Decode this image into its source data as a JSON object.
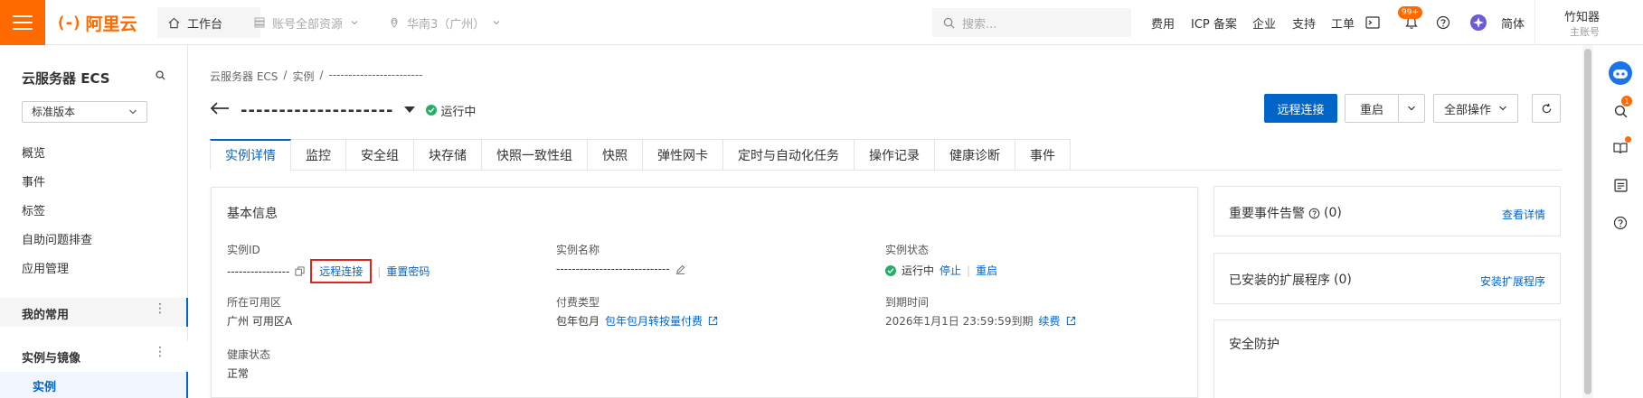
{
  "topbar": {
    "logo_text": "阿里云",
    "logo_mark": "(-)",
    "workbench": "工作台",
    "account_scope": "账号全部资源",
    "region": "华南3（广州）",
    "search_placeholder": "搜索...",
    "links": [
      "费用",
      "ICP 备案",
      "企业",
      "支持",
      "工单"
    ],
    "notify_badge": "99+",
    "lang": "简体",
    "user_name": "竹知器",
    "user_sub": "主账号",
    "accent_color": "#ff6a00"
  },
  "sidebar": {
    "title": "云服务器 ECS",
    "version": "标准版本",
    "items": [
      "概览",
      "事件",
      "标签",
      "自助问题排查",
      "应用管理"
    ],
    "section_favorites": "我的常用",
    "section_instances": "实例与镜像",
    "active_item": "实例"
  },
  "breadcrumb": [
    "云服务器 ECS",
    "/",
    "实例",
    "/",
    "------------------------"
  ],
  "header": {
    "instance_title": "--------------------",
    "status": "运行中",
    "btn_remote": "远程连接",
    "btn_restart": "重启",
    "btn_all_ops": "全部操作",
    "primary_color": "#0064c8"
  },
  "tabs": [
    "实例详情",
    "监控",
    "安全组",
    "块存储",
    "快照一致性组",
    "快照",
    "弹性网卡",
    "定时与自动化任务",
    "操作记录",
    "健康诊断",
    "事件"
  ],
  "basic_info": {
    "title": "基本信息",
    "instance_id_label": "实例ID",
    "instance_id_value": "----------------",
    "remote_link": "远程连接",
    "reset_pwd_link": "重置密码",
    "name_label": "实例名称",
    "name_value": "-----------------------------",
    "state_label": "实例状态",
    "state_value": "运行中",
    "stop_link": "停止",
    "restart_link": "重启",
    "zone_label": "所在可用区",
    "zone_value": "广州 可用区A",
    "pay_label": "付费类型",
    "pay_value": "包年包月",
    "pay_convert_link": "包年包月转按量付费",
    "expire_label": "到期时间",
    "expire_value": "2026年1月1日 23:59:59到期",
    "renew_link": "续费",
    "health_label": "健康状态",
    "health_value": "正常"
  },
  "right_cards": {
    "events_title": "重要事件告警",
    "events_count": "(0)",
    "events_link": "查看详情",
    "ext_title": "已安装的扩展程序",
    "ext_count": "(0)",
    "ext_link": "安装扩展程序",
    "security_title": "安全防护"
  },
  "tool_badge": "1"
}
